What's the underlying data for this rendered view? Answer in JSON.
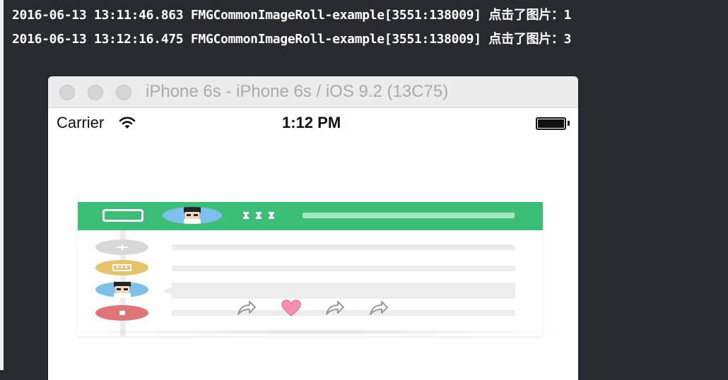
{
  "console": {
    "log_lines": [
      "2016-06-13 13:11:46.863 FMGCommonImageRoll-example[3551:138009] 点击了图片：1",
      "2016-06-13 13:12:16.475 FMGCommonImageRoll-example[3551:138009] 点击了图片：3"
    ]
  },
  "simulator": {
    "window_title": "iPhone 6s - iPhone 6s / iOS 9.2 (13C75)",
    "status_bar": {
      "carrier": "Carrier",
      "time": "1:12 PM",
      "icons": [
        "wifi-icon",
        "battery-icon"
      ]
    },
    "banner_image": {
      "icons": [
        "tablet-icon",
        "avatar-icon",
        "share-icon",
        "heart-icon",
        "share-icon",
        "share-icon"
      ]
    }
  },
  "colors": {
    "console_background": "#292a30",
    "console_text": "#ffffff",
    "banner_green": "#3bbf76",
    "avatar_blue": "#7ec0ec",
    "dot_gray": "#d8d8d8",
    "dot_yellow": "#e6c46e",
    "dot_red": "#e07575",
    "heart_pink": "#f58fb2"
  }
}
